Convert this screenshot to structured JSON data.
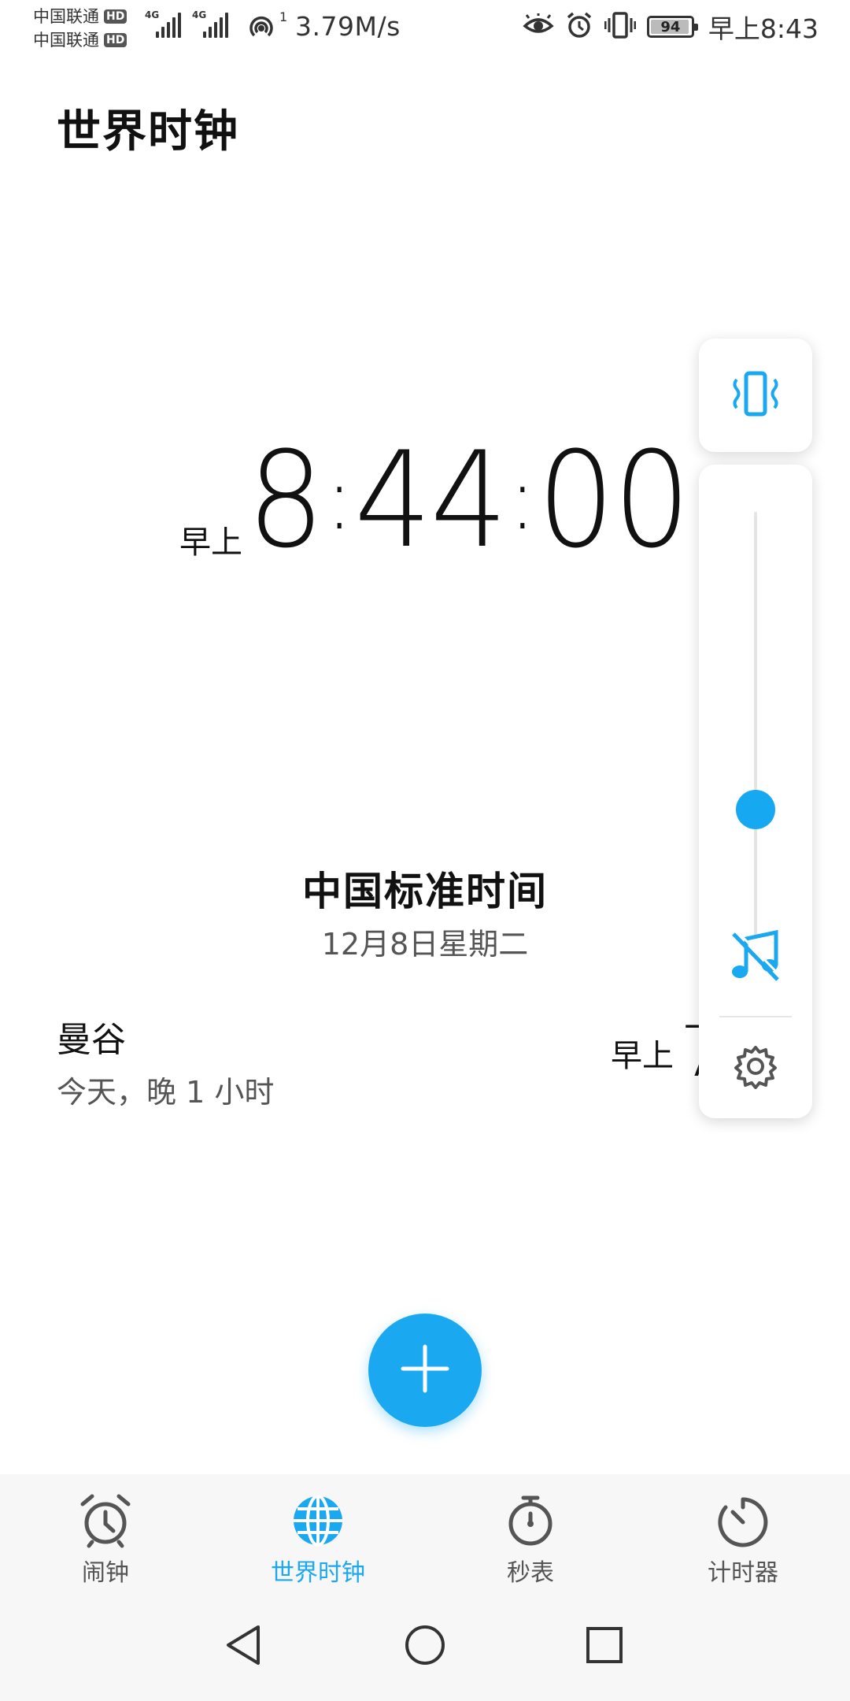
{
  "status_bar": {
    "carrier_1": "中国联通",
    "carrier_2": "中国联通",
    "hd_badge": "HD",
    "network_type": "4G",
    "hotspot_count": "1",
    "network_speed": "3.79M/s",
    "battery_level": "94",
    "time": "早上8:43",
    "icons": [
      "eye-comfort-icon",
      "alarm-icon",
      "vibrate-icon",
      "battery-icon"
    ]
  },
  "header": {
    "title": "世界时钟"
  },
  "main_clock": {
    "ampm": "早上",
    "hour": "8",
    "minute": "44",
    "second": "00",
    "separator": ":",
    "timezone_name": "中国标准时间",
    "date": "12月8日星期二"
  },
  "cities": [
    {
      "name": "曼谷",
      "offset": "今天，晚 1 小时",
      "ampm": "早上",
      "time_visible": "7"
    }
  ],
  "volume_panel": {
    "level": 0.3,
    "icons": [
      "vibrate-mode-icon",
      "music-muted-icon",
      "gear-icon"
    ]
  },
  "fab": {
    "icon": "plus-icon"
  },
  "tabs": [
    {
      "label": "闹钟",
      "icon": "alarm-clock-icon",
      "active": false
    },
    {
      "label": "世界时钟",
      "icon": "globe-icon",
      "active": true
    },
    {
      "label": "秒表",
      "icon": "stopwatch-icon",
      "active": false
    },
    {
      "label": "计时器",
      "icon": "timer-icon",
      "active": false
    }
  ],
  "nav_bar": {
    "icons": [
      "back-icon",
      "home-icon",
      "recents-icon"
    ]
  },
  "colors": {
    "accent": "#1aa8f0",
    "text": "#111111",
    "secondary_text": "#555555",
    "tab_bar_bg": "#f7f7f7"
  }
}
